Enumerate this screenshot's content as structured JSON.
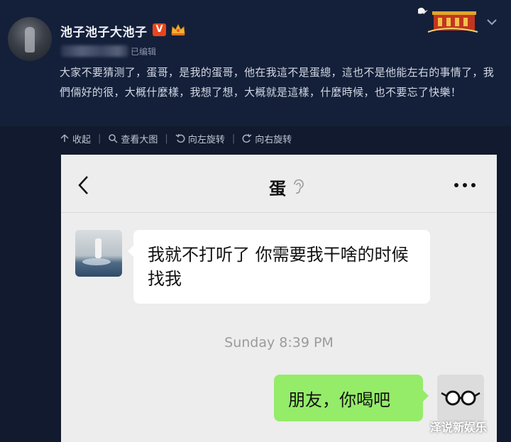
{
  "post": {
    "username": "池子池子大池子",
    "verified_badge": "V",
    "edited_label": "已编辑",
    "text": "大家不要猜测了，蛋哥，是我的蛋哥，他在我這不是蛋總，這也不是他能左右的事情了，我們倆好的很，大概什麼樣，我想了想，大概就是這樣，什麼時候，也不要忘了快樂！",
    "icons": [
      "avatar",
      "verified-badge",
      "crown-icon",
      "decoration-image",
      "chevron-down-icon"
    ]
  },
  "toolbar": {
    "collapse_label": "收起",
    "view_large_label": "查看大图",
    "rotate_left_label": "向左旋转",
    "rotate_right_label": "向右旋转",
    "separator": "|"
  },
  "chat": {
    "title": "蛋",
    "icons": [
      "back-arrow-icon",
      "ear-icon",
      "more-icon"
    ],
    "messages": [
      {
        "side": "left",
        "text": "我就不打听了 你需要我干啥的时候找我"
      },
      {
        "side": "right",
        "text": "朋友，你喝吧"
      }
    ],
    "timestamp": "Sunday 8:39 PM",
    "colors": {
      "background": "#ededed",
      "incoming_bubble": "#ffffff",
      "outgoing_bubble": "#95ec69"
    }
  },
  "watermark": "泽说新娱乐",
  "colors": {
    "page_background": "#111a2e",
    "verified_badge": "#e8451c"
  }
}
